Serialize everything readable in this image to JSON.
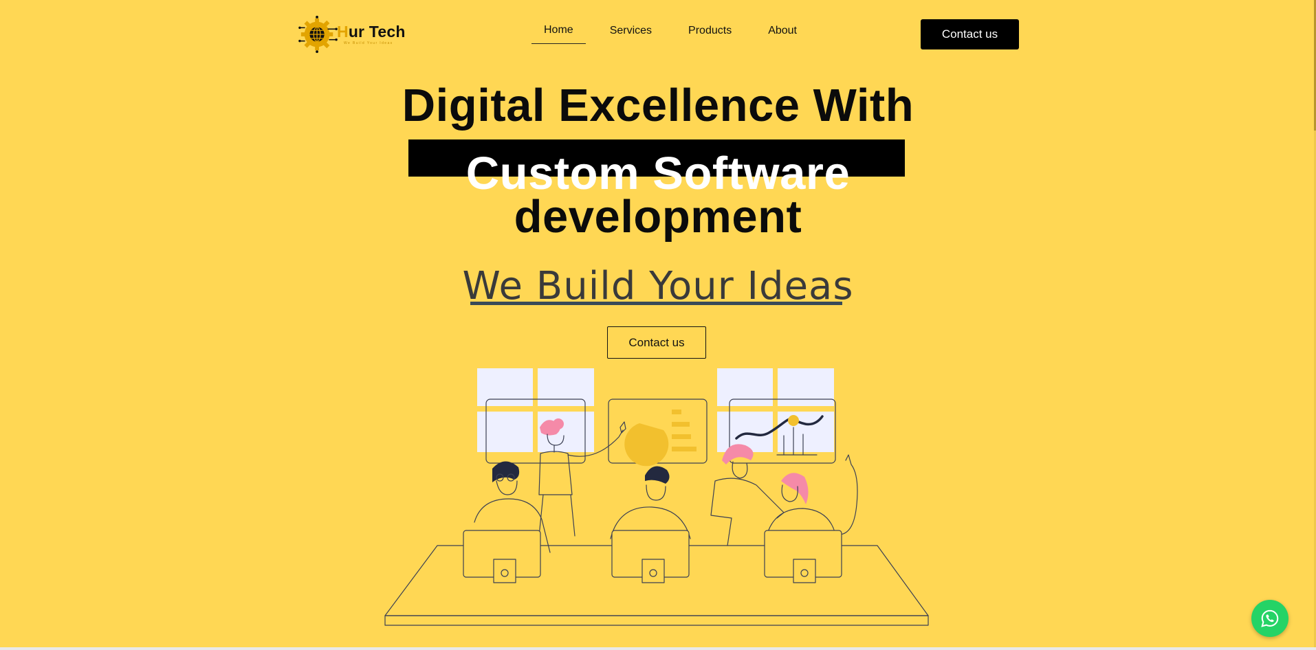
{
  "header": {
    "logo": {
      "name_initial": "H",
      "name_rest": "ur Tech",
      "tagline": "We Build Your Ideas"
    },
    "nav": [
      {
        "label": "Home",
        "active": true
      },
      {
        "label": "Services"
      },
      {
        "label": "Products"
      },
      {
        "label": "About"
      }
    ],
    "cta_label": "Contact us"
  },
  "hero": {
    "line1": "Digital Excellence With",
    "line2": "Custom Software",
    "line3": "development",
    "tagline": "We Build Your Ideas",
    "cta_label": "Contact us"
  },
  "colors": {
    "background": "#FFD754",
    "accent": "#E2A400",
    "text": "#0b0b0b",
    "whatsapp": "#25D366",
    "illustration_pink": "#F58AA8"
  },
  "icons": [
    "gear-globe-logo-icon",
    "whatsapp-icon"
  ]
}
